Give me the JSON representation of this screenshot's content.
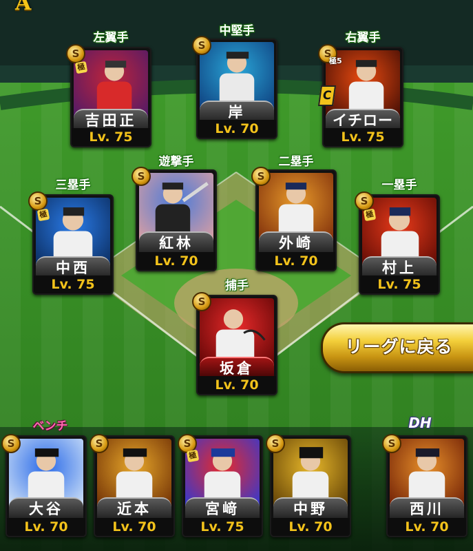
{
  "grade_badge": "A",
  "return_button_label": "リーグに戻る",
  "positions": [
    {
      "pos": "左翼手",
      "name": "吉田正",
      "level": "Lv. 75",
      "rank": "S",
      "kiwami": "極",
      "art": "#c0243a",
      "art2": "#4a1a6a",
      "name_style": "gray"
    },
    {
      "pos": "中堅手",
      "name": "岸",
      "level": "Lv. 70",
      "rank": "S",
      "kiwami": "",
      "art": "#2aa7d8",
      "art2": "#0d3a7a",
      "name_style": "gray"
    },
    {
      "pos": "右翼手",
      "name": "イチロー",
      "level": "Lv. 75",
      "rank": "S",
      "kiwami": "",
      "badge_c": "C",
      "hatsu": "極5",
      "art": "#e84a10",
      "art2": "#3a0a04",
      "name_style": "gray"
    },
    {
      "pos": "三塁手",
      "name": "中西",
      "level": "Lv. 75",
      "rank": "S",
      "kiwami": "極",
      "art": "#2a7be8",
      "art2": "#0a2a5a",
      "name_style": "gray"
    },
    {
      "pos": "遊撃手",
      "name": "紅林",
      "level": "Lv. 70",
      "rank": "S",
      "kiwami": "",
      "art": "#4a7ad8",
      "art2": "#e0a0a0",
      "name_style": "gray"
    },
    {
      "pos": "二塁手",
      "name": "外崎",
      "level": "Lv. 70",
      "rank": "S",
      "kiwami": "",
      "art": "#e89a2a",
      "art2": "#7a2a0a",
      "name_style": "gray"
    },
    {
      "pos": "一塁手",
      "name": "村上",
      "level": "Lv. 75",
      "rank": "S",
      "kiwami": "極",
      "art": "#e83a1a",
      "art2": "#5a0a04",
      "name_style": "gray"
    },
    {
      "pos": "捕手",
      "name": "坂倉",
      "level": "Lv. 70",
      "rank": "S",
      "kiwami": "",
      "art": "#e82a2a",
      "art2": "#5a0404",
      "name_style": "red"
    }
  ],
  "bench_label": "ベンチ",
  "dh_label": "DH",
  "bench": [
    {
      "name": "大谷",
      "level": "Lv. 70",
      "rank": "S",
      "kiwami": "",
      "art": "#2a6ae8",
      "art2": "#d8e8f8"
    },
    {
      "name": "近本",
      "level": "Lv. 70",
      "rank": "S",
      "kiwami": "",
      "art": "#e8a82a",
      "art2": "#6a2a04"
    },
    {
      "name": "宮﨑",
      "level": "Lv. 75",
      "rank": "S",
      "kiwami": "極",
      "art": "#e82a2a",
      "art2": "#2a3ad8"
    },
    {
      "name": "中野",
      "level": "Lv. 70",
      "rank": "S",
      "kiwami": "",
      "art": "#e8b82a",
      "art2": "#5a3a04"
    },
    {
      "name": "西川",
      "level": "Lv. 70",
      "rank": "S",
      "kiwami": "",
      "art": "#e8902a",
      "art2": "#6a1a04"
    }
  ]
}
